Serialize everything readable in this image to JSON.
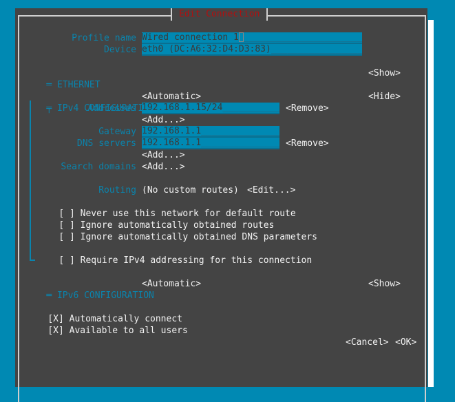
{
  "dialog": {
    "title": "Edit Connection"
  },
  "profile": {
    "name_label": "Profile name",
    "name_value": "Wired connection 1",
    "device_label": "Device",
    "device_value": "eth0 (DC:A6:32:D4:D3:83)"
  },
  "ethernet": {
    "mark": "═",
    "label": "ETHERNET",
    "toggle": "<Show>"
  },
  "ipv4": {
    "mark": "╤",
    "label": "IPv4 CONFIGURATION",
    "mode": "<Automatic>",
    "toggle": "<Hide>",
    "addresses_label": "Addresses",
    "address_value": "192.168.1.15/24",
    "remove_label": "<Remove>",
    "add_label": "<Add...>",
    "gateway_label": "Gateway",
    "gateway_value": "192.168.1.1",
    "dns_label": "DNS servers",
    "dns_value": "192.168.1.1",
    "search_domains_label": "Search domains",
    "routing_label": "Routing",
    "routing_value": "(No custom routes)",
    "routing_edit": "<Edit...>",
    "checkboxes": [
      {
        "state": "[ ]",
        "label": "Never use this network for default route"
      },
      {
        "state": "[ ]",
        "label": "Ignore automatically obtained routes"
      },
      {
        "state": "[ ]",
        "label": "Ignore automatically obtained DNS parameters"
      },
      {
        "state": "[ ]",
        "label": "Require IPv4 addressing for this connection"
      }
    ]
  },
  "ipv6": {
    "mark": "═",
    "label": "IPv6 CONFIGURATION",
    "mode": "<Automatic>",
    "toggle": "<Show>"
  },
  "general": {
    "checkboxes": [
      {
        "state": "[X]",
        "label": "Automatically connect"
      },
      {
        "state": "[X]",
        "label": "Available to all users"
      }
    ]
  },
  "actions": {
    "cancel": "<Cancel>",
    "ok": "<OK>"
  },
  "colors": {
    "background": "#0089b3",
    "dialog": "#444444",
    "label": "#0a84ad",
    "title": "#b20f0f",
    "field": "#0089b3"
  }
}
